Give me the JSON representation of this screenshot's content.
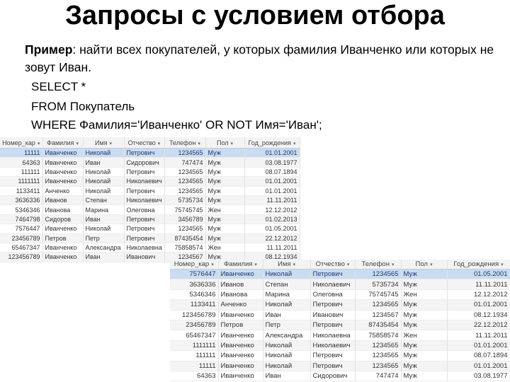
{
  "title": "Запросы с условием отбора",
  "example_label": "Пример",
  "example_text": ": найти всех покупателей, у которых фамилия Иванченко или которых не зовут Иван.",
  "sql": [
    "SELECT *",
    "FROM Покупатель",
    "WHERE Фамилия='Иванченко' OR NOT Имя='Иван';"
  ],
  "columns": [
    "Номер_кар",
    "Фамилия",
    "Имя",
    "Отчество",
    "Телефон",
    "Пол",
    "Год_рождения"
  ],
  "table_before": [
    [
      "11111",
      "Иванченко",
      "Николай",
      "Петрович",
      "1234565",
      "Муж",
      "01.01.2001"
    ],
    [
      "64363",
      "Иванченко",
      "Иван",
      "Сидорович",
      "747474",
      "Муж",
      "03.08.1977"
    ],
    [
      "111111",
      "Иванченко",
      "Николай",
      "Петрович",
      "1234565",
      "Муж",
      "08.07.1894"
    ],
    [
      "1111111",
      "Иванченко",
      "Николай",
      "Николаевич",
      "1234565",
      "Муж",
      "01.01.2001"
    ],
    [
      "1133411",
      "Анченко",
      "Николай",
      "Петрович",
      "1234565",
      "Муж",
      "01.01.2001"
    ],
    [
      "3636336",
      "Иванов",
      "Степан",
      "Николаевич",
      "5735734",
      "Муж",
      "11.11.2011"
    ],
    [
      "5346346",
      "Иванова",
      "Марина",
      "Олеговна",
      "75745745",
      "Жен",
      "12.12.2012"
    ],
    [
      "7464798",
      "Сидоров",
      "Иван",
      "Петрович",
      "3456789",
      "Муж",
      "01.02.2013"
    ],
    [
      "7576447",
      "Иванченко",
      "Николай",
      "Петрович",
      "1234565",
      "Муж",
      "01.05.2001"
    ],
    [
      "23456789",
      "Петров",
      "Петр",
      "Петрович",
      "87435454",
      "Муж",
      "22.12.2012"
    ],
    [
      "65467347",
      "Иванченко",
      "Александра",
      "Николаевна",
      "75858574",
      "Жен",
      "11.11.2011"
    ],
    [
      "123456789",
      "Иванченко",
      "Иван",
      "Иванович",
      "1234567",
      "Муж",
      "08.12.1934"
    ]
  ],
  "table_result": [
    [
      "7576447",
      "Иванченко",
      "Николай",
      "Петрович",
      "1234565",
      "Муж",
      "01.05.2001"
    ],
    [
      "3636336",
      "Иванов",
      "Степан",
      "Николаевич",
      "5735734",
      "Муж",
      "11.11.2011"
    ],
    [
      "5346346",
      "Иванова",
      "Марина",
      "Олеговна",
      "75745745",
      "Жен",
      "12.12.2012"
    ],
    [
      "1133411",
      "Анченко",
      "Николай",
      "Петрович",
      "1234565",
      "Муж",
      "01.01.2001"
    ],
    [
      "123456789",
      "Иванченко",
      "Иван",
      "Иванович",
      "1234567",
      "Муж",
      "08.12.1934"
    ],
    [
      "23456789",
      "Петров",
      "Петр",
      "Петрович",
      "87435454",
      "Муж",
      "22.12.2012"
    ],
    [
      "65467347",
      "Иванченко",
      "Александра",
      "Николаевна",
      "75858574",
      "Жен",
      "11.11.2011"
    ],
    [
      "1111111",
      "Иванченко",
      "Николай",
      "Николаевич",
      "1234565",
      "Муж",
      "01.01.2001"
    ],
    [
      "111111",
      "Иванченко",
      "Николай",
      "Петрович",
      "1234565",
      "Муж",
      "08.07.1894"
    ],
    [
      "11111",
      "Иванченко",
      "Николай",
      "Петрович",
      "1234565",
      "Муж",
      "01.01.2001"
    ],
    [
      "64363",
      "Иванченко",
      "Иван",
      "Сидорович",
      "747474",
      "Муж",
      "03.08.1977"
    ]
  ],
  "selection_color": "#c8dcf2"
}
